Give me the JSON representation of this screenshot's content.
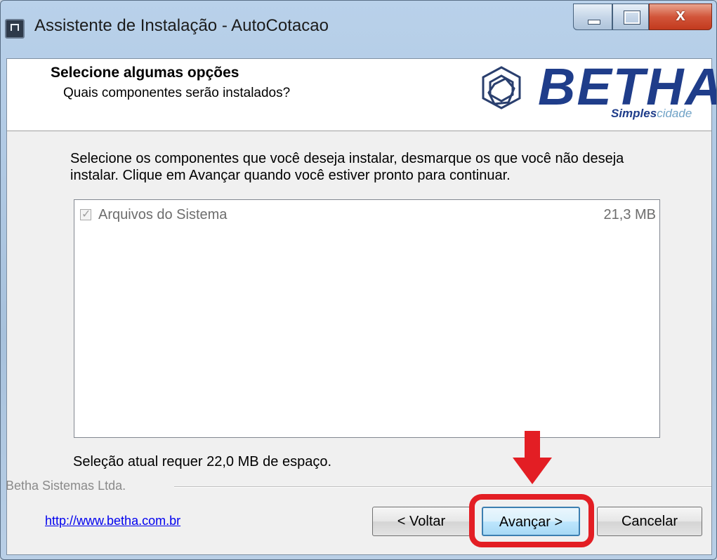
{
  "window": {
    "title": "Assistente de Instalação - AutoCotacao",
    "close_glyph": "x"
  },
  "header": {
    "title": "Selecione algumas opções",
    "subtitle": "Quais componentes serão instalados?",
    "logo": {
      "word": "BETHA",
      "tag_bold": "Simples",
      "tag_light": "cidade"
    }
  },
  "body": {
    "description": "Selecione os componentes que você deseja instalar, desmarque os que você não deseja instalar. Clique em Avançar quando você estiver pronto para continuar.",
    "components": [
      {
        "label": "Arquivos do Sistema",
        "size": "21,3 MB",
        "checked": true,
        "disabled": true
      }
    ],
    "space_required": "Seleção atual requer 22,0 MB de espaço."
  },
  "footer": {
    "brand": "Betha Sistemas Ltda.",
    "link": "http://www.betha.com.br",
    "back_label": "< Voltar",
    "next_label": "Avançar >",
    "cancel_label": "Cancelar"
  },
  "colors": {
    "accent_red": "#e31e24",
    "brand_blue": "#1f3d8a",
    "link_blue": "#0000ee"
  }
}
